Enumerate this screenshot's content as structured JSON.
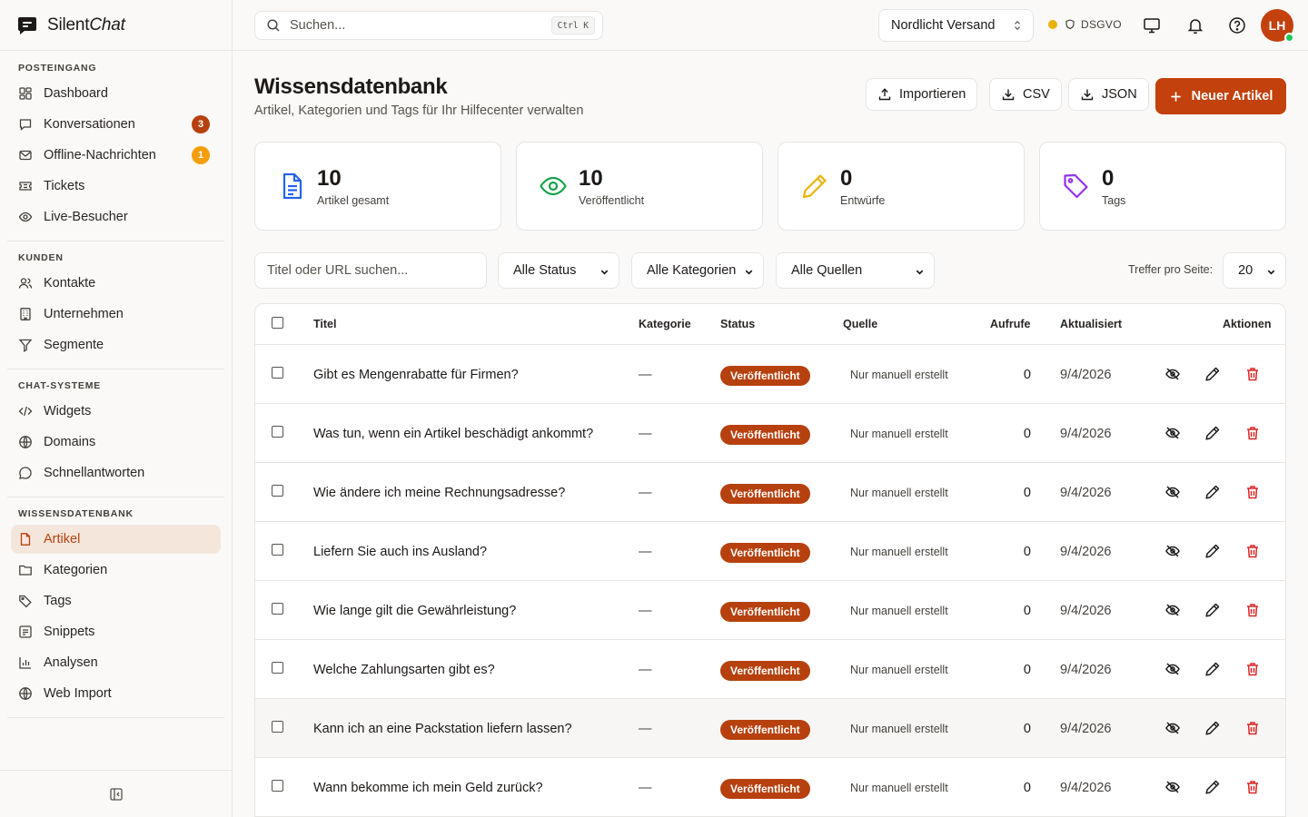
{
  "brand": {
    "name_regular": "Silent",
    "name_italic": "Chat",
    "accent": "#c2410c"
  },
  "sidebar": {
    "sections": [
      {
        "heading": "POSTEINGANG",
        "items": [
          {
            "label": "Dashboard",
            "icon": "dashboard-icon"
          },
          {
            "label": "Konversationen",
            "icon": "chat-bubble-icon",
            "badge": "3"
          },
          {
            "label": "Offline-Nachrichten",
            "icon": "mail-icon",
            "badge": "1"
          },
          {
            "label": "Tickets",
            "icon": "ticket-icon"
          },
          {
            "label": "Live-Besucher",
            "icon": "eye-icon"
          }
        ]
      },
      {
        "heading": "KUNDEN",
        "items": [
          {
            "label": "Kontakte",
            "icon": "users-icon"
          },
          {
            "label": "Unternehmen",
            "icon": "building-icon"
          },
          {
            "label": "Segmente",
            "icon": "filter-icon"
          }
        ]
      },
      {
        "heading": "CHAT-SYSTEME",
        "items": [
          {
            "label": "Widgets",
            "icon": "code-icon"
          },
          {
            "label": "Domains",
            "icon": "globe-icon"
          },
          {
            "label": "Schnellantworten",
            "icon": "message-circle-icon"
          }
        ]
      },
      {
        "heading": "WISSENSDATENBANK",
        "items": [
          {
            "label": "Artikel",
            "icon": "file-icon",
            "active": true
          },
          {
            "label": "Kategorien",
            "icon": "folder-icon"
          },
          {
            "label": "Tags",
            "icon": "tag-icon"
          },
          {
            "label": "Snippets",
            "icon": "snippet-icon"
          },
          {
            "label": "Analysen",
            "icon": "bar-chart-icon"
          },
          {
            "label": "Web Import",
            "icon": "globe-icon"
          }
        ]
      }
    ]
  },
  "topbar": {
    "search_placeholder": "Suchen...",
    "shortcut": "Ctrl K",
    "workspace": "Nordlicht Versand",
    "compliance_label": "DSGVO",
    "avatar_initials": "LH"
  },
  "page": {
    "title": "Wissensdatenbank",
    "subtitle": "Artikel, Kategorien und Tags für Ihr Hilfecenter verwalten",
    "buttons": {
      "import": "Importieren",
      "csv": "CSV",
      "json": "JSON",
      "new": "Neuer Artikel"
    }
  },
  "stats": [
    {
      "value": "10",
      "label": "Artikel gesamt",
      "icon": "document-icon",
      "color": "#2563eb"
    },
    {
      "value": "10",
      "label": "Veröffentlicht",
      "icon": "eye-icon",
      "color": "#16a34a"
    },
    {
      "value": "0",
      "label": "Entwürfe",
      "icon": "pencil-icon",
      "color": "#eab308"
    },
    {
      "value": "0",
      "label": "Tags",
      "icon": "tag-icon",
      "color": "#9333ea"
    }
  ],
  "filters": {
    "search_placeholder": "Titel oder URL suchen...",
    "status": "Alle Status",
    "category": "Alle Kategorien",
    "source": "Alle Quellen",
    "per_page_label": "Treffer pro Seite:",
    "per_page": "20"
  },
  "table": {
    "columns": [
      "Titel",
      "Kategorie",
      "Status",
      "Quelle",
      "Aufrufe",
      "Aktualisiert",
      "Aktionen"
    ],
    "rows": [
      {
        "title": "Gibt es Mengenrabatte für Firmen?",
        "category": "—",
        "status": "Veröffentlicht",
        "source": "Nur manuell erstellt",
        "views": "0",
        "updated": "9/4/2026"
      },
      {
        "title": "Was tun, wenn ein Artikel beschädigt ankommt?",
        "category": "—",
        "status": "Veröffentlicht",
        "source": "Nur manuell erstellt",
        "views": "0",
        "updated": "9/4/2026"
      },
      {
        "title": "Wie ändere ich meine Rechnungsadresse?",
        "category": "—",
        "status": "Veröffentlicht",
        "source": "Nur manuell erstellt",
        "views": "0",
        "updated": "9/4/2026"
      },
      {
        "title": "Liefern Sie auch ins Ausland?",
        "category": "—",
        "status": "Veröffentlicht",
        "source": "Nur manuell erstellt",
        "views": "0",
        "updated": "9/4/2026"
      },
      {
        "title": "Wie lange gilt die Gewährleistung?",
        "category": "—",
        "status": "Veröffentlicht",
        "source": "Nur manuell erstellt",
        "views": "0",
        "updated": "9/4/2026"
      },
      {
        "title": "Welche Zahlungsarten gibt es?",
        "category": "—",
        "status": "Veröffentlicht",
        "source": "Nur manuell erstellt",
        "views": "0",
        "updated": "9/4/2026"
      },
      {
        "title": "Kann ich an eine Packstation liefern lassen?",
        "category": "—",
        "status": "Veröffentlicht",
        "source": "Nur manuell erstellt",
        "views": "0",
        "updated": "9/4/2026"
      },
      {
        "title": "Wann bekomme ich mein Geld zurück?",
        "category": "—",
        "status": "Veröffentlicht",
        "source": "Nur manuell erstellt",
        "views": "0",
        "updated": "9/4/2026"
      }
    ]
  }
}
